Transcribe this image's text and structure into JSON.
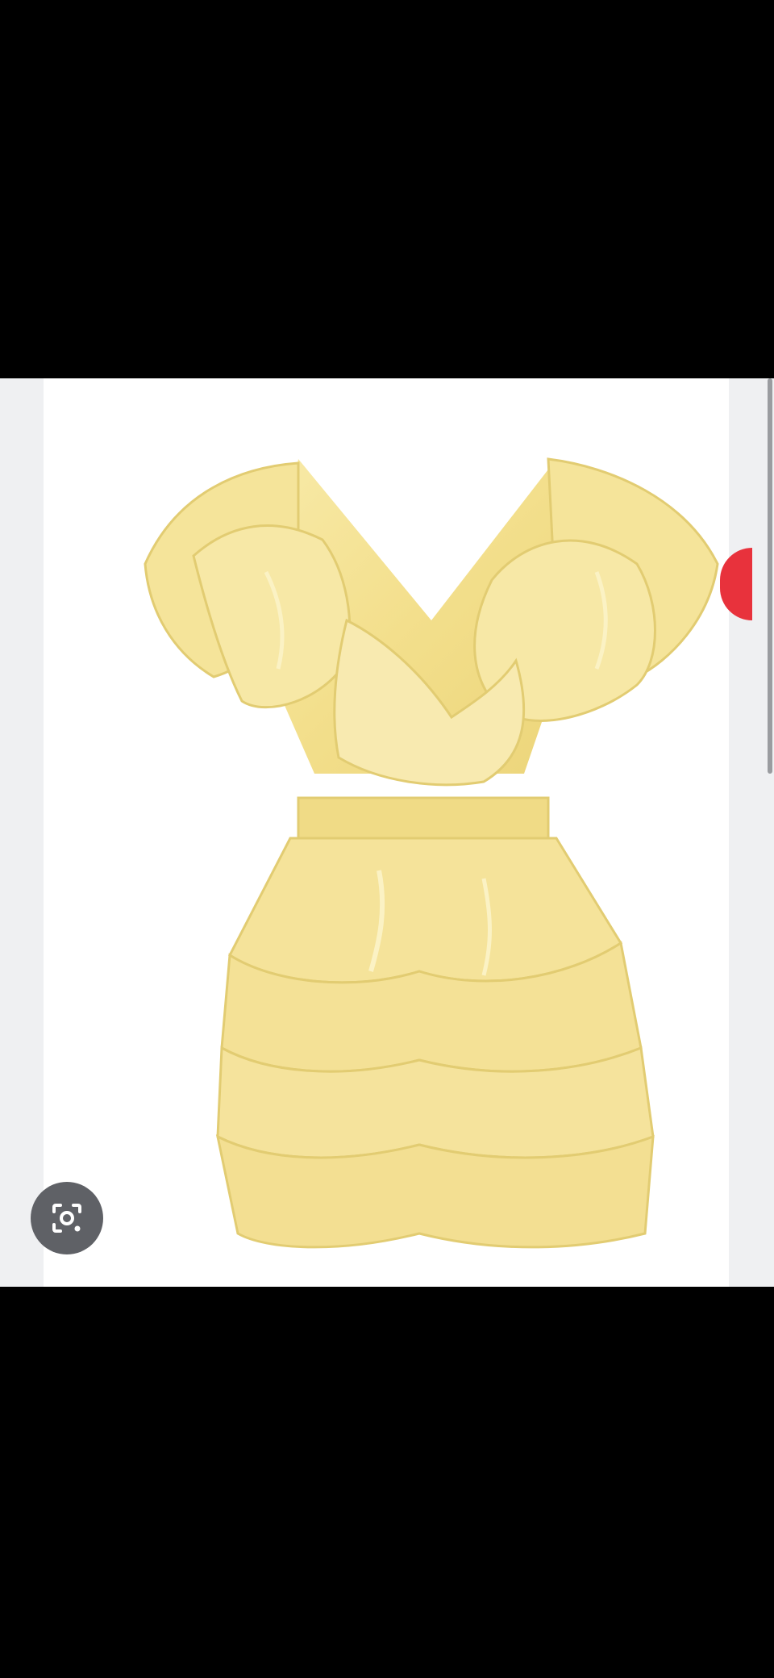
{
  "screen": {
    "background_color": "#000000",
    "viewer_background_color": "#eff0f2",
    "image_background_color": "#ffffff"
  },
  "product_image": {
    "subject": "yellow-ruffled-dress",
    "fabric_color": "#f5e49a",
    "shadow_color": "#e2cc72",
    "highlight_color": "#fbf2c4"
  },
  "lens_button": {
    "icon": "lens-search-icon",
    "color": "#5f6166"
  },
  "next_image_indicator": {
    "color": "#e8323c"
  }
}
